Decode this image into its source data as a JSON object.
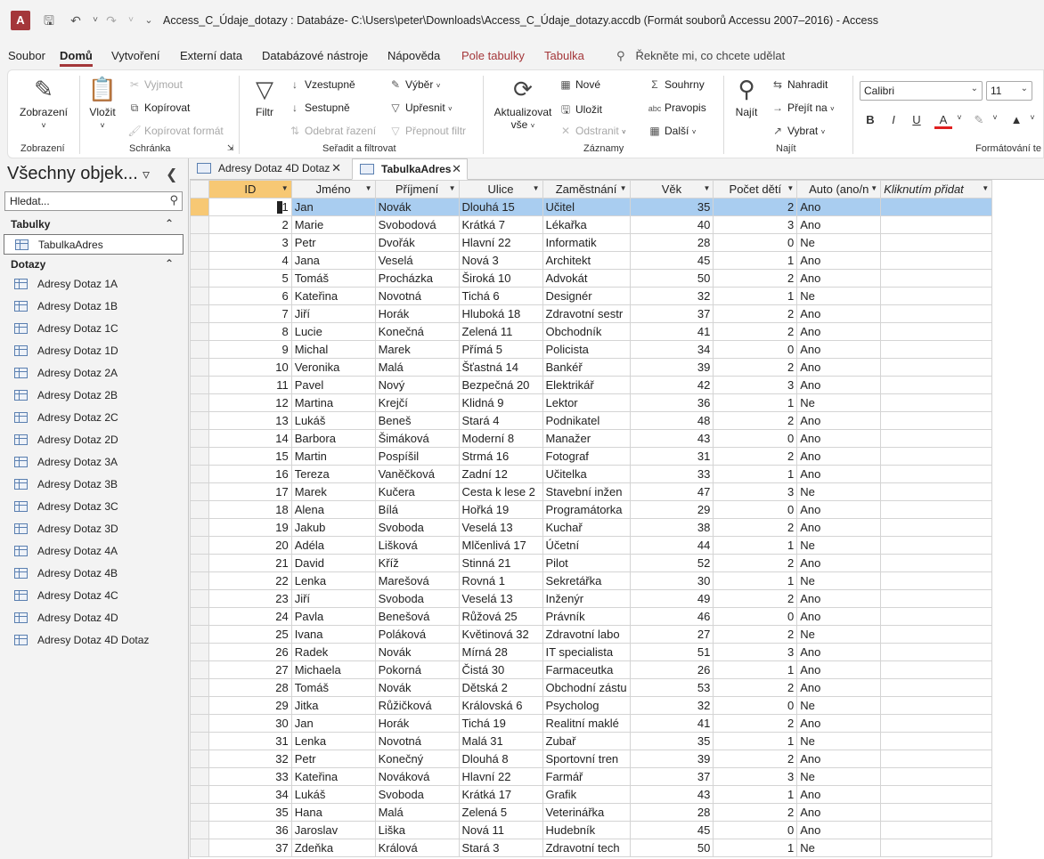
{
  "title_bar": {
    "app_icon": "A",
    "title": "Access_C_Údaje_dotazy : Databáze- C:\\Users\\peter\\Downloads\\Access_C_Údaje_dotazy.accdb (Formát souborů Accessu 2007–2016)  -  Access"
  },
  "menu": {
    "tabs": [
      "Soubor",
      "Domů",
      "Vytvoření",
      "Externí data",
      "Databázové nástroje",
      "Nápověda",
      "Pole tabulky",
      "Tabulka"
    ],
    "tell_me": "Řekněte mi, co chcete udělat"
  },
  "ribbon": {
    "zobrazeni": {
      "button": "Zobrazení",
      "group": "Zobrazení"
    },
    "schranka": {
      "vlozit": "Vložit",
      "vyjmout": "Vyjmout",
      "kopirovat": "Kopírovat",
      "kopirovat_format": "Kopírovat formát",
      "group": "Schránka"
    },
    "filtr": {
      "filtr": "Filtr",
      "vzestupne": "Vzestupně",
      "sestupne": "Sestupně",
      "odebrat_razeni": "Odebrat řazení",
      "vyber": "Výběr",
      "upresnit": "Upřesnit",
      "prepnout_filtr": "Přepnout filtr",
      "group": "Seřadit a filtrovat"
    },
    "zaznamy": {
      "aktualizovat": "Aktualizovat vše",
      "nove": "Nové",
      "ulozit": "Uložit",
      "odstranit": "Odstranit",
      "souhrny": "Souhrny",
      "pravopis": "Pravopis",
      "dalsi": "Další",
      "group": "Záznamy"
    },
    "najit": {
      "najit": "Najít",
      "nahradit": "Nahradit",
      "prejit_na": "Přejít na",
      "vybrat": "Vybrat",
      "group": "Najít"
    },
    "format": {
      "font": "Calibri",
      "size": "11",
      "group": "Formátování te"
    }
  },
  "nav": {
    "title": "Všechny objek...",
    "search_placeholder": "Hledat...",
    "sections": {
      "tables": "Tabulky",
      "queries": "Dotazy"
    },
    "tables": [
      "TabulkaAdres"
    ],
    "queries": [
      "Adresy Dotaz 1A",
      "Adresy Dotaz 1B",
      "Adresy Dotaz 1C",
      "Adresy Dotaz 1D",
      "Adresy Dotaz 2A",
      "Adresy Dotaz 2B",
      "Adresy Dotaz 2C",
      "Adresy Dotaz 2D",
      "Adresy Dotaz 3A",
      "Adresy Dotaz 3B",
      "Adresy Dotaz 3C",
      "Adresy Dotaz 3D",
      "Adresy Dotaz 4A",
      "Adresy Dotaz 4B",
      "Adresy Dotaz 4C",
      "Adresy Dotaz 4D",
      "Adresy Dotaz 4D Dotaz"
    ]
  },
  "doc_tabs": [
    "Adresy Dotaz 4D Dotaz",
    "TabulkaAdres"
  ],
  "sheet": {
    "columns": [
      "ID",
      "Jméno",
      "Příjmení",
      "Ulice",
      "Zaměstnání",
      "Věk",
      "Počet dětí",
      "Auto (ano/n",
      "Kliknutím přidat"
    ],
    "rows": [
      [
        "1",
        "Jan",
        "Novák",
        "Dlouhá 15",
        "Učitel",
        "35",
        "2",
        "Ano"
      ],
      [
        "2",
        "Marie",
        "Svobodová",
        "Krátká 7",
        "Lékařka",
        "40",
        "3",
        "Ano"
      ],
      [
        "3",
        "Petr",
        "Dvořák",
        "Hlavní 22",
        "Informatik",
        "28",
        "0",
        "Ne"
      ],
      [
        "4",
        "Jana",
        "Veselá",
        "Nová 3",
        "Architekt",
        "45",
        "1",
        "Ano"
      ],
      [
        "5",
        "Tomáš",
        "Procházka",
        "Široká 10",
        "Advokát",
        "50",
        "2",
        "Ano"
      ],
      [
        "6",
        "Kateřina",
        "Novotná",
        "Tichá 6",
        "Designér",
        "32",
        "1",
        "Ne"
      ],
      [
        "7",
        "Jiří",
        "Horák",
        "Hluboká 18",
        "Zdravotní sestr",
        "37",
        "2",
        "Ano"
      ],
      [
        "8",
        "Lucie",
        "Konečná",
        "Zelená 11",
        "Obchodník",
        "41",
        "2",
        "Ano"
      ],
      [
        "9",
        "Michal",
        "Marek",
        "Přímá 5",
        "Policista",
        "34",
        "0",
        "Ano"
      ],
      [
        "10",
        "Veronika",
        "Malá",
        "Šťastná 14",
        "Bankéř",
        "39",
        "2",
        "Ano"
      ],
      [
        "11",
        "Pavel",
        "Nový",
        "Bezpečná 20",
        "Elektrikář",
        "42",
        "3",
        "Ano"
      ],
      [
        "12",
        "Martina",
        "Krejčí",
        "Klidná 9",
        "Lektor",
        "36",
        "1",
        "Ne"
      ],
      [
        "13",
        "Lukáš",
        "Beneš",
        "Stará 4",
        "Podnikatel",
        "48",
        "2",
        "Ano"
      ],
      [
        "14",
        "Barbora",
        "Šimáková",
        "Moderní 8",
        "Manažer",
        "43",
        "0",
        "Ano"
      ],
      [
        "15",
        "Martin",
        "Pospíšil",
        "Strmá 16",
        "Fotograf",
        "31",
        "2",
        "Ano"
      ],
      [
        "16",
        "Tereza",
        "Vaněčková",
        "Zadní 12",
        "Učitelka",
        "33",
        "1",
        "Ano"
      ],
      [
        "17",
        "Marek",
        "Kučera",
        "Cesta k lese 2",
        "Stavební inžen",
        "47",
        "3",
        "Ne"
      ],
      [
        "18",
        "Alena",
        "Bílá",
        "Hořká 19",
        "Programátorka",
        "29",
        "0",
        "Ano"
      ],
      [
        "19",
        "Jakub",
        "Svoboda",
        "Veselá 13",
        "Kuchař",
        "38",
        "2",
        "Ano"
      ],
      [
        "20",
        "Adéla",
        "Lišková",
        "Mlčenlivá 17",
        "Účetní",
        "44",
        "1",
        "Ne"
      ],
      [
        "21",
        "David",
        "Kříž",
        "Stinná 21",
        "Pilot",
        "52",
        "2",
        "Ano"
      ],
      [
        "22",
        "Lenka",
        "Marešová",
        "Rovná 1",
        "Sekretářka",
        "30",
        "1",
        "Ne"
      ],
      [
        "23",
        "Jiří",
        "Svoboda",
        "Veselá 13",
        "Inženýr",
        "49",
        "2",
        "Ano"
      ],
      [
        "24",
        "Pavla",
        "Benešová",
        "Růžová 25",
        "Právník",
        "46",
        "0",
        "Ano"
      ],
      [
        "25",
        "Ivana",
        "Poláková",
        "Květinová 32",
        "Zdravotní labo",
        "27",
        "2",
        "Ne"
      ],
      [
        "26",
        "Radek",
        "Novák",
        "Mírná 28",
        "IT specialista",
        "51",
        "3",
        "Ano"
      ],
      [
        "27",
        "Michaela",
        "Pokorná",
        "Čistá 30",
        "Farmaceutka",
        "26",
        "1",
        "Ano"
      ],
      [
        "28",
        "Tomáš",
        "Novák",
        "Dětská 2",
        "Obchodní zástu",
        "53",
        "2",
        "Ano"
      ],
      [
        "29",
        "Jitka",
        "Růžičková",
        "Královská 6",
        "Psycholog",
        "32",
        "0",
        "Ne"
      ],
      [
        "30",
        "Jan",
        "Horák",
        "Tichá 19",
        "Realitní maklé",
        "41",
        "2",
        "Ano"
      ],
      [
        "31",
        "Lenka",
        "Novotná",
        "Malá 31",
        "Zubař",
        "35",
        "1",
        "Ne"
      ],
      [
        "32",
        "Petr",
        "Konečný",
        "Dlouhá 8",
        "Sportovní tren",
        "39",
        "2",
        "Ano"
      ],
      [
        "33",
        "Kateřina",
        "Nováková",
        "Hlavní 22",
        "Farmář",
        "37",
        "3",
        "Ne"
      ],
      [
        "34",
        "Lukáš",
        "Svoboda",
        "Krátká 17",
        "Grafik",
        "43",
        "1",
        "Ano"
      ],
      [
        "35",
        "Hana",
        "Malá",
        "Zelená 5",
        "Veterinářka",
        "28",
        "2",
        "Ano"
      ],
      [
        "36",
        "Jaroslav",
        "Liška",
        "Nová 11",
        "Hudebník",
        "45",
        "0",
        "Ano"
      ],
      [
        "37",
        "Zdeňka",
        "Králová",
        "Stará 3",
        "Zdravotní tech",
        "50",
        "1",
        "Ne"
      ]
    ]
  },
  "colors": {
    "accent": "#a4373a",
    "selected_row": "#a9cdf0",
    "selected_header": "#f7c874"
  }
}
